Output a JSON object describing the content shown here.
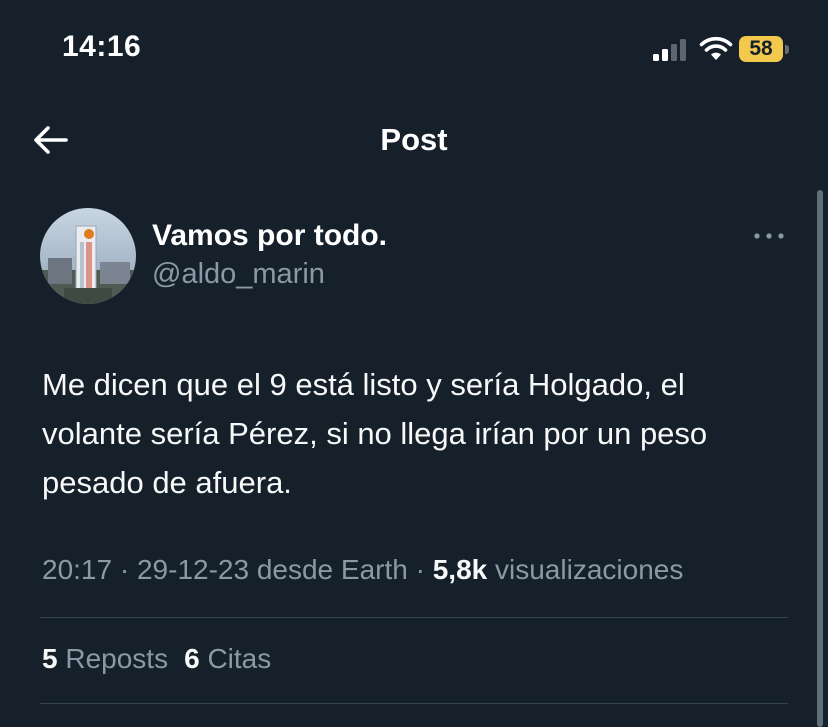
{
  "status_bar": {
    "time": "14:16",
    "battery_level": "58",
    "battery_color": "#f2c94c"
  },
  "nav": {
    "title": "Post",
    "back_icon": "arrow-left-icon"
  },
  "tweet": {
    "display_name": "Vamos por todo.",
    "handle": "@aldo_marin",
    "text": "Me dicen que el 9 está listo y sería Holgado, el volante sería Pérez, si no llega irían por un peso pesado de afuera.",
    "time": "20:17",
    "date": "29-12-23",
    "source": "desde Earth",
    "separator": "·",
    "views_count": "5,8k",
    "views_label": "visualizaciones",
    "more_icon": "more-horizontal-icon"
  },
  "engagement": {
    "reposts_count": "5",
    "reposts_label": "Reposts",
    "quotes_count": "6",
    "quotes_label": "Citas"
  },
  "colors": {
    "background": "#15202b",
    "text_primary": "#f7f9f9",
    "text_secondary": "#8b98a5",
    "divider": "#38444d"
  }
}
